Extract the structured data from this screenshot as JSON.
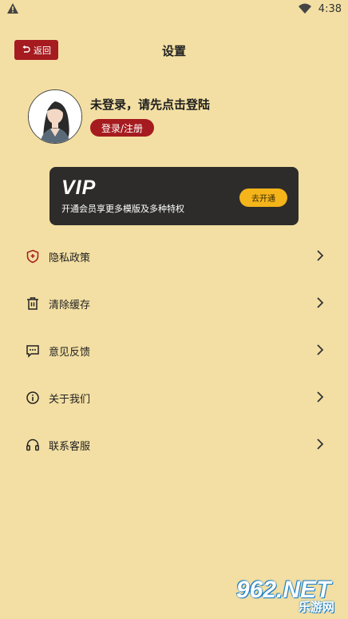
{
  "status_bar": {
    "time": "4:38",
    "warning_icon": "warning-icon",
    "wifi_icon": "wifi-icon"
  },
  "header": {
    "back_label": "返回",
    "title": "设置"
  },
  "profile": {
    "prompt": "未登录，请先点击登陆",
    "login_button": "登录/注册"
  },
  "vip": {
    "title": "VIP",
    "description": "开通会员享更多模版及多种特权",
    "button": "去开通",
    "accent": "#F4B41A"
  },
  "menu": [
    {
      "label": "隐私政策",
      "icon": "shield-icon"
    },
    {
      "label": "清除缓存",
      "icon": "trash-icon"
    },
    {
      "label": "意见反馈",
      "icon": "feedback-icon"
    },
    {
      "label": "关于我们",
      "icon": "info-icon"
    },
    {
      "label": "联系客服",
      "icon": "headset-icon"
    }
  ],
  "watermark": {
    "logo": "962.NET",
    "site": "乐游网"
  },
  "colors": {
    "background": "#F3DFA3",
    "brand_red": "#A51B1F",
    "vip_card": "#2D2C2B"
  }
}
